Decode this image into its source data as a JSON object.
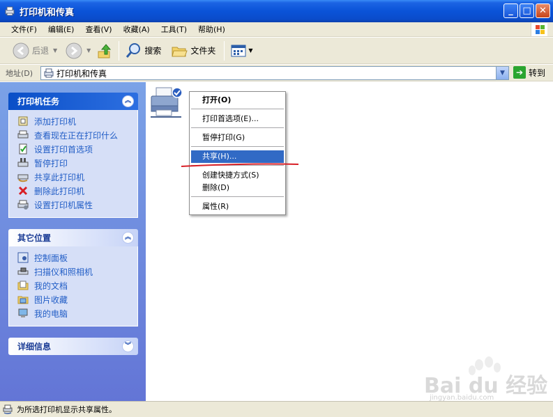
{
  "window": {
    "title": "打印机和传真"
  },
  "menubar": {
    "items": [
      "文件(F)",
      "编辑(E)",
      "查看(V)",
      "收藏(A)",
      "工具(T)",
      "帮助(H)"
    ]
  },
  "toolbar": {
    "back_label": "后退",
    "search_label": "搜索",
    "folders_label": "文件夹"
  },
  "address": {
    "label": "地址(D)",
    "value": "打印机和传真",
    "go_label": "转到"
  },
  "left_pane": {
    "printer_tasks": {
      "title": "打印机任务",
      "items": [
        "添加打印机",
        "查看现在正在打印什么",
        "设置打印首选项",
        "暂停打印",
        "共享此打印机",
        "删除此打印机",
        "设置打印机属性"
      ]
    },
    "other_places": {
      "title": "其它位置",
      "items": [
        "控制面板",
        "扫描仪和照相机",
        "我的文档",
        "图片收藏",
        "我的电脑"
      ]
    },
    "details": {
      "title": "详细信息"
    }
  },
  "context_menu": {
    "open": "打开(O)",
    "prefs": "打印首选项(E)...",
    "pause": "暂停打印(G)",
    "share": "共享(H)...",
    "shortcut": "创建快捷方式(S)",
    "delete": "删除(D)",
    "properties": "属性(R)",
    "selected": "共享(H)..."
  },
  "statusbar": {
    "text": "为所选打印机显示共享属性。"
  },
  "watermark": {
    "brand": "Bai du 经验",
    "url": "jingyan.baidu.com"
  },
  "colors": {
    "title_blue": "#0a53d8",
    "menu_select": "#316ac5",
    "link_blue": "#215dc6",
    "task_pane": "#7ba2e7",
    "annotation_red": "#d81f26"
  }
}
